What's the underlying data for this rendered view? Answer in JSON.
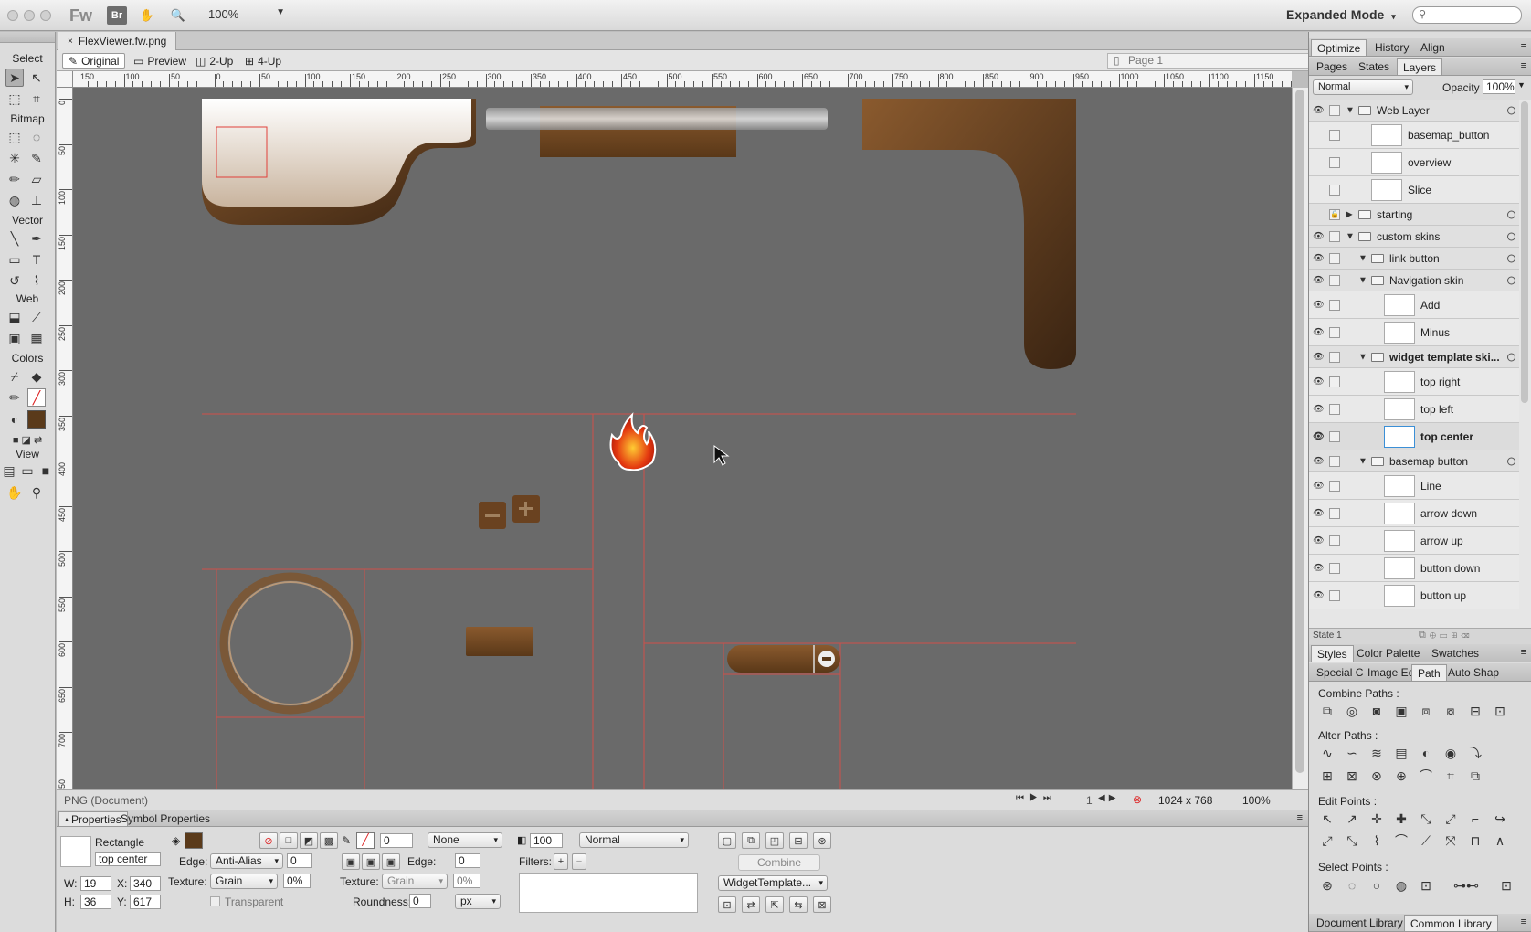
{
  "app": {
    "logo": "Fw",
    "bridge_label": "Br",
    "zoom": "100%",
    "mode": "Expanded Mode"
  },
  "document": {
    "tab_title": "FlexViewer.fw.png",
    "view_tabs": [
      "Original",
      "Preview",
      "2-Up",
      "4-Up"
    ],
    "page": "Page 1",
    "ruler_h": [
      "150",
      "100",
      "50",
      "0",
      "50",
      "100",
      "150",
      "200",
      "250",
      "300",
      "350",
      "400",
      "450",
      "500",
      "550",
      "600",
      "650",
      "700",
      "750",
      "800",
      "850",
      "900",
      "950",
      "1000",
      "1050",
      "1100",
      "1150"
    ],
    "ruler_v": [
      "0",
      "50",
      "100",
      "150",
      "200",
      "250",
      "300",
      "350",
      "400",
      "450",
      "500",
      "550",
      "600",
      "650",
      "700",
      "750"
    ],
    "status_left": "PNG (Document)",
    "frame": "1",
    "canvas_size": "1024 x 768",
    "status_zoom": "100%"
  },
  "tools": {
    "sections": [
      "Select",
      "Bitmap",
      "Vector",
      "Web",
      "Colors",
      "View"
    ]
  },
  "properties": {
    "tabs": [
      "Properties",
      "Symbol Properties"
    ],
    "object_type": "Rectangle",
    "object_name": "top center",
    "edge_label": "Edge:",
    "edge_value": "Anti-Alias",
    "edge_amount": "0",
    "texture_label": "Texture:",
    "texture_value": "Grain",
    "texture_amount": "0%",
    "transparent_label": "Transparent",
    "stroke_size": "0",
    "stroke_type": "None",
    "stroke_edge_label": "Edge:",
    "stroke_edge_amount": "0",
    "stroke_texture_label": "Texture:",
    "stroke_texture_value": "Grain",
    "stroke_texture_amount": "0%",
    "roundness_label": "Roundness:",
    "roundness_value": "0",
    "roundness_unit": "px",
    "opacity": "100",
    "blend": "Normal",
    "filters_label": "Filters:",
    "combine_label": "Combine",
    "widget_template": "WidgetTemplate...",
    "w_label": "W:",
    "w_value": "19",
    "x_label": "X:",
    "x_value": "340",
    "h_label": "H:",
    "h_value": "36",
    "y_label": "Y:",
    "y_value": "617",
    "fill_color": "#5a3a1a"
  },
  "right_panel": {
    "top_tabs": [
      "Optimize",
      "History",
      "Align"
    ],
    "layers_tabs": [
      "Pages",
      "States",
      "Layers"
    ],
    "blend": "Normal",
    "opacity_label": "Opacity",
    "opacity_value": "100%",
    "layers": [
      {
        "name": "Web Layer",
        "kind": "folder",
        "indent": 0
      },
      {
        "name": "basemap_button",
        "kind": "item",
        "indent": 1
      },
      {
        "name": "overview",
        "kind": "item",
        "indent": 1
      },
      {
        "name": "Slice",
        "kind": "item",
        "indent": 1
      },
      {
        "name": "starting",
        "kind": "folder",
        "indent": 0
      },
      {
        "name": "custom skins",
        "kind": "folder",
        "indent": 0
      },
      {
        "name": "link button",
        "kind": "folder",
        "indent": 1
      },
      {
        "name": "Navigation skin",
        "kind": "folder",
        "indent": 1
      },
      {
        "name": "Add",
        "kind": "item",
        "indent": 2
      },
      {
        "name": "Minus",
        "kind": "item",
        "indent": 2
      },
      {
        "name": "widget template ski...",
        "kind": "folder",
        "indent": 1
      },
      {
        "name": "top right",
        "kind": "item",
        "indent": 2
      },
      {
        "name": "top left",
        "kind": "item",
        "indent": 2
      },
      {
        "name": "top center",
        "kind": "item",
        "indent": 2
      },
      {
        "name": "basemap button",
        "kind": "folder",
        "indent": 1
      },
      {
        "name": "Line",
        "kind": "item",
        "indent": 2
      },
      {
        "name": "arrow down",
        "kind": "item",
        "indent": 2
      },
      {
        "name": "arrow up",
        "kind": "item",
        "indent": 2
      },
      {
        "name": "button down",
        "kind": "item",
        "indent": 2
      },
      {
        "name": "button up",
        "kind": "item",
        "indent": 2
      }
    ],
    "state_label": "State 1",
    "styles_tabs": [
      "Styles",
      "Color Palette",
      "Swatches"
    ],
    "path_tabs": [
      "Special C",
      "Image Ed",
      "Path",
      "Auto Shap"
    ],
    "combine_paths": "Combine Paths :",
    "alter_paths": "Alter Paths :",
    "edit_points": "Edit Points :",
    "select_points": "Select Points :",
    "library_tabs": [
      "Document Library",
      "Common Library"
    ]
  }
}
